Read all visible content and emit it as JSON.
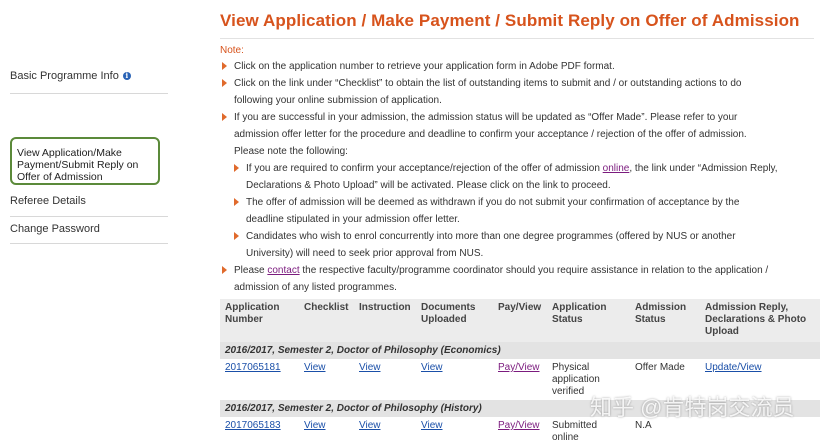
{
  "sidebar": {
    "basic_info": "Basic Programme Info",
    "view_app": "View Application/Make Payment/Submit Reply on Offer of Admission",
    "referee": "Referee Details",
    "change_password": "Change Password"
  },
  "page": {
    "title": "View Application / Make Payment / Submit Reply on Offer of Admission",
    "note_label": "Note:"
  },
  "notes": {
    "n1": "Click on the application number to retrieve your application form in Adobe PDF format.",
    "n2a": "Click on the link under “Checklist” to obtain the list of outstanding items to submit and / or outstanding actions to do",
    "n2b": "following your online submission of application.",
    "n3a": "If you are successful in your admission, the admission status will be updated as “Offer Made”. Please refer to your",
    "n3b": "admission offer letter for the procedure and deadline to confirm your acceptance / rejection of the offer of admission.",
    "n3c": "Please note the following:",
    "s1_pre": "If you are required to confirm your acceptance/rejection of the offer of admission ",
    "s1_link": "online",
    "s1_post": ", the link under “Admission Reply,",
    "s1b": "Declarations & Photo Upload” will be activated. Please click on the link to proceed.",
    "s2a": "The offer of admission will be deemed as withdrawn if you do not submit your confirmation of acceptance by the",
    "s2b": "deadline stipulated in your admission offer letter.",
    "s3a": "Candidates who wish to enrol concurrently into more than one degree programmes (offered by NUS or another",
    "s3b": "University) will need to seek prior approval from NUS.",
    "n4_pre": "Please ",
    "n4_link": "contact",
    "n4_post": " the respective faculty/programme coordinator should you require assistance in relation to the application /",
    "n4b": "admission of any listed programmes."
  },
  "table": {
    "headers": [
      "Application Number",
      "Checklist",
      "Instruction",
      "Documents Uploaded",
      "Pay/View",
      "Application Status",
      "Admission Status",
      "Admission Reply, Declarations & Photo Upload"
    ],
    "group1": "2016/2017, Semester 2, Doctor of Philosophy (Economics)",
    "row1": {
      "app_no": "2017065181",
      "checklist": "View",
      "instruction": "View",
      "documents": "View",
      "pay": "Pay/View",
      "app_status": "Physical application verified",
      "adm_status": "Offer Made",
      "reply": "Update/View"
    },
    "group2": "2016/2017, Semester 2, Doctor of Philosophy (History)",
    "row2": {
      "app_no": "2017065183",
      "checklist": "View",
      "instruction": "View",
      "documents": "View",
      "pay": "Pay/View",
      "app_status": "Submitted online",
      "adm_status": "N.A",
      "reply": ""
    }
  },
  "watermark": "知乎 @肯特岗交流员"
}
